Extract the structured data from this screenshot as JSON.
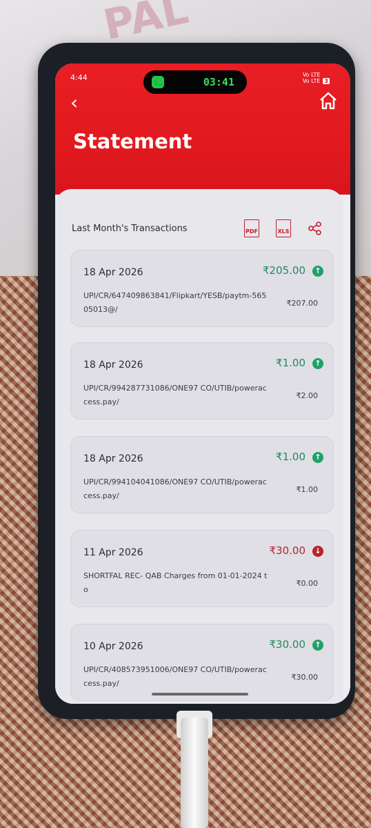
{
  "status": {
    "time": "4:44",
    "call_timer": "03:41",
    "signal_text": "Vo LTE\nVo LTE",
    "battery": "3"
  },
  "header": {
    "title": "Statement"
  },
  "panel": {
    "heading": "Last Month's Transactions",
    "actions": [
      {
        "label": "PDF",
        "icon": "pdf-icon"
      },
      {
        "label": "XLS",
        "icon": "xls-icon"
      },
      {
        "icon": "share-icon"
      }
    ]
  },
  "transactions": [
    {
      "date": "18 Apr 2026",
      "amount": "₹205.00",
      "direction": "credit",
      "description": "UPI/CR/647409863841/Flipkart/YESB/paytm-56505013@/",
      "balance": "₹207.00"
    },
    {
      "date": "18 Apr 2026",
      "amount": "₹1.00",
      "direction": "credit",
      "description": "UPI/CR/994287731086/ONE97 CO/UTIB/poweraccess.pay/",
      "balance": "₹2.00"
    },
    {
      "date": "18 Apr 2026",
      "amount": "₹1.00",
      "direction": "credit",
      "description": "UPI/CR/994104041086/ONE97 CO/UTIB/poweraccess.pay/",
      "balance": "₹1.00"
    },
    {
      "date": "11 Apr 2026",
      "amount": "₹30.00",
      "direction": "debit",
      "description": "SHORTFAL REC- QAB Charges from 01-01-2024 to",
      "balance": "₹0.00"
    },
    {
      "date": "10 Apr 2026",
      "amount": "₹30.00",
      "direction": "credit",
      "description": "UPI/CR/408573951006/ONE97 CO/UTIB/poweraccess.pay/",
      "balance": "₹30.00"
    }
  ],
  "colors": {
    "brand_red": "#e21a1f",
    "credit_green": "#23a06a",
    "debit_red": "#b8222d"
  }
}
